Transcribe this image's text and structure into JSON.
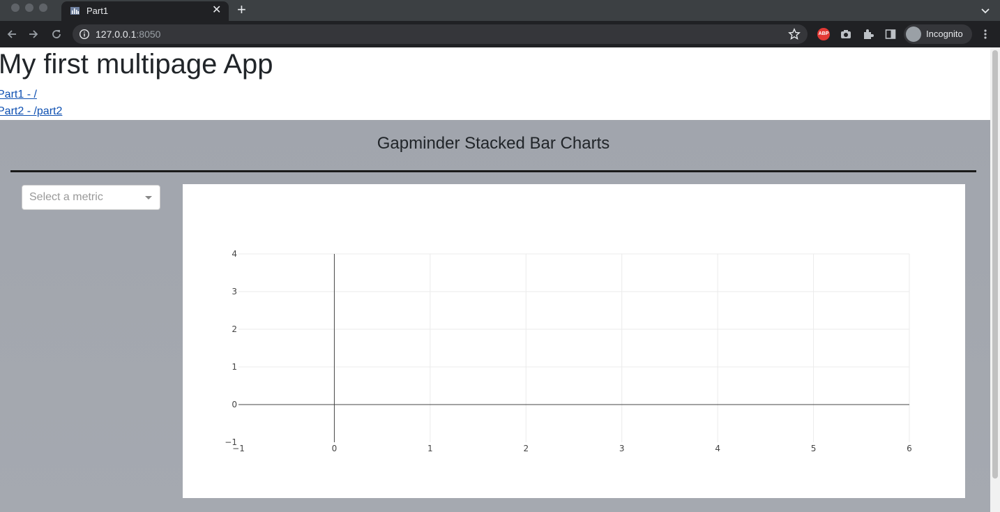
{
  "browser": {
    "tab_title": "Part1",
    "url_host": "127.0.0.1",
    "url_port": ":8050",
    "profile_label": "Incognito",
    "abp_label": "ABP"
  },
  "page": {
    "title": "My first multipage App",
    "links": [
      "Part1 - /",
      "Part2 - /part2"
    ]
  },
  "dashboard": {
    "title": "Gapminder Stacked Bar Charts",
    "dropdown_placeholder": "Select a metric"
  },
  "chart_data": {
    "type": "bar",
    "series": [],
    "xlim": [
      -1,
      6
    ],
    "ylim": [
      -1,
      4
    ],
    "xticks": [
      -1,
      0,
      1,
      2,
      3,
      4,
      5,
      6
    ],
    "yticks": [
      -1,
      0,
      1,
      2,
      3,
      4
    ],
    "grid": true
  }
}
